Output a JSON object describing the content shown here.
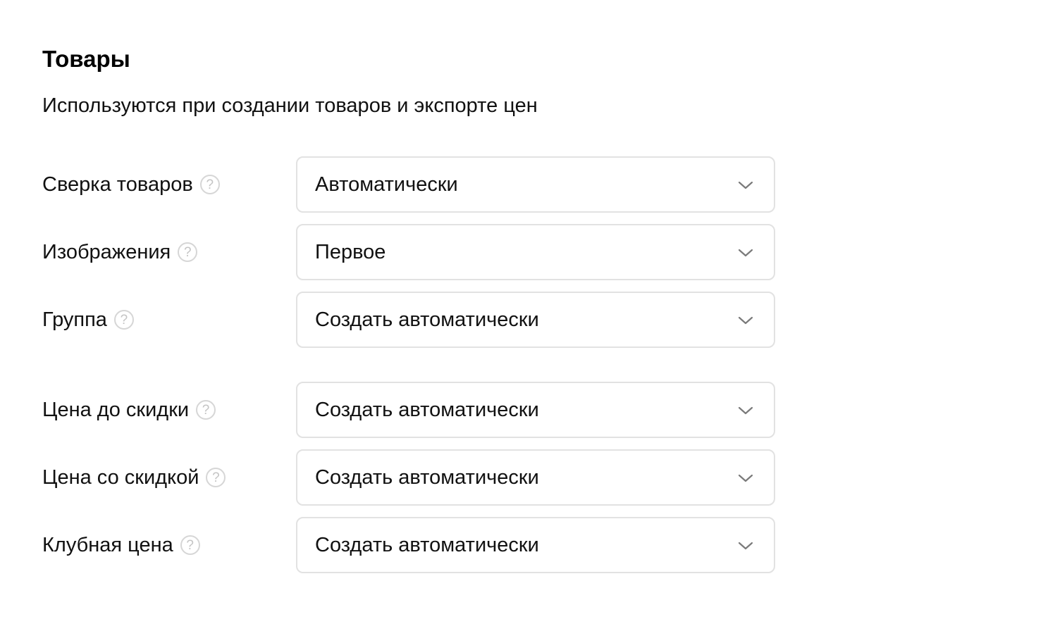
{
  "section": {
    "title": "Товары",
    "subtitle": "Используются при создании товаров и экспорте цен"
  },
  "help_icon_glyph": "?",
  "rows": [
    {
      "label": "Сверка товаров",
      "value": "Автоматически"
    },
    {
      "label": "Изображения",
      "value": "Первое"
    },
    {
      "label": "Группа",
      "value": "Создать автоматически"
    },
    {
      "label": "Цена до скидки",
      "value": "Создать автоматически"
    },
    {
      "label": "Цена со скидкой",
      "value": "Создать автоматически"
    },
    {
      "label": "Клубная цена",
      "value": "Создать автоматически"
    }
  ],
  "colors": {
    "border": "#e2e2e2",
    "help_icon": "#c4c4c4",
    "chevron": "#7a7a7a"
  }
}
